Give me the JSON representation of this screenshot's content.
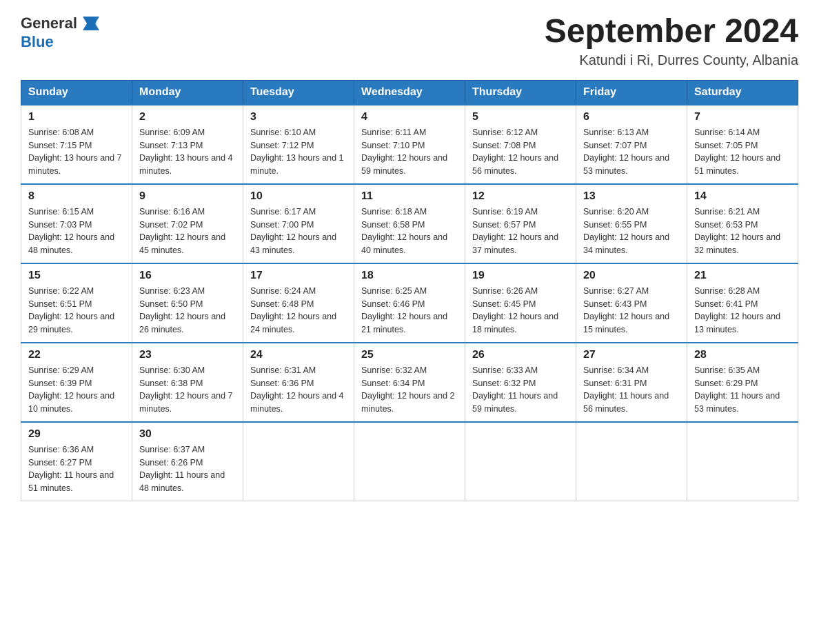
{
  "header": {
    "logo_general": "General",
    "logo_blue": "Blue",
    "month_title": "September 2024",
    "location": "Katundi i Ri, Durres County, Albania"
  },
  "weekdays": [
    "Sunday",
    "Monday",
    "Tuesday",
    "Wednesday",
    "Thursday",
    "Friday",
    "Saturday"
  ],
  "weeks": [
    [
      {
        "day": "1",
        "sunrise": "6:08 AM",
        "sunset": "7:15 PM",
        "daylight": "13 hours and 7 minutes."
      },
      {
        "day": "2",
        "sunrise": "6:09 AM",
        "sunset": "7:13 PM",
        "daylight": "13 hours and 4 minutes."
      },
      {
        "day": "3",
        "sunrise": "6:10 AM",
        "sunset": "7:12 PM",
        "daylight": "13 hours and 1 minute."
      },
      {
        "day": "4",
        "sunrise": "6:11 AM",
        "sunset": "7:10 PM",
        "daylight": "12 hours and 59 minutes."
      },
      {
        "day": "5",
        "sunrise": "6:12 AM",
        "sunset": "7:08 PM",
        "daylight": "12 hours and 56 minutes."
      },
      {
        "day": "6",
        "sunrise": "6:13 AM",
        "sunset": "7:07 PM",
        "daylight": "12 hours and 53 minutes."
      },
      {
        "day": "7",
        "sunrise": "6:14 AM",
        "sunset": "7:05 PM",
        "daylight": "12 hours and 51 minutes."
      }
    ],
    [
      {
        "day": "8",
        "sunrise": "6:15 AM",
        "sunset": "7:03 PM",
        "daylight": "12 hours and 48 minutes."
      },
      {
        "day": "9",
        "sunrise": "6:16 AM",
        "sunset": "7:02 PM",
        "daylight": "12 hours and 45 minutes."
      },
      {
        "day": "10",
        "sunrise": "6:17 AM",
        "sunset": "7:00 PM",
        "daylight": "12 hours and 43 minutes."
      },
      {
        "day": "11",
        "sunrise": "6:18 AM",
        "sunset": "6:58 PM",
        "daylight": "12 hours and 40 minutes."
      },
      {
        "day": "12",
        "sunrise": "6:19 AM",
        "sunset": "6:57 PM",
        "daylight": "12 hours and 37 minutes."
      },
      {
        "day": "13",
        "sunrise": "6:20 AM",
        "sunset": "6:55 PM",
        "daylight": "12 hours and 34 minutes."
      },
      {
        "day": "14",
        "sunrise": "6:21 AM",
        "sunset": "6:53 PM",
        "daylight": "12 hours and 32 minutes."
      }
    ],
    [
      {
        "day": "15",
        "sunrise": "6:22 AM",
        "sunset": "6:51 PM",
        "daylight": "12 hours and 29 minutes."
      },
      {
        "day": "16",
        "sunrise": "6:23 AM",
        "sunset": "6:50 PM",
        "daylight": "12 hours and 26 minutes."
      },
      {
        "day": "17",
        "sunrise": "6:24 AM",
        "sunset": "6:48 PM",
        "daylight": "12 hours and 24 minutes."
      },
      {
        "day": "18",
        "sunrise": "6:25 AM",
        "sunset": "6:46 PM",
        "daylight": "12 hours and 21 minutes."
      },
      {
        "day": "19",
        "sunrise": "6:26 AM",
        "sunset": "6:45 PM",
        "daylight": "12 hours and 18 minutes."
      },
      {
        "day": "20",
        "sunrise": "6:27 AM",
        "sunset": "6:43 PM",
        "daylight": "12 hours and 15 minutes."
      },
      {
        "day": "21",
        "sunrise": "6:28 AM",
        "sunset": "6:41 PM",
        "daylight": "12 hours and 13 minutes."
      }
    ],
    [
      {
        "day": "22",
        "sunrise": "6:29 AM",
        "sunset": "6:39 PM",
        "daylight": "12 hours and 10 minutes."
      },
      {
        "day": "23",
        "sunrise": "6:30 AM",
        "sunset": "6:38 PM",
        "daylight": "12 hours and 7 minutes."
      },
      {
        "day": "24",
        "sunrise": "6:31 AM",
        "sunset": "6:36 PM",
        "daylight": "12 hours and 4 minutes."
      },
      {
        "day": "25",
        "sunrise": "6:32 AM",
        "sunset": "6:34 PM",
        "daylight": "12 hours and 2 minutes."
      },
      {
        "day": "26",
        "sunrise": "6:33 AM",
        "sunset": "6:32 PM",
        "daylight": "11 hours and 59 minutes."
      },
      {
        "day": "27",
        "sunrise": "6:34 AM",
        "sunset": "6:31 PM",
        "daylight": "11 hours and 56 minutes."
      },
      {
        "day": "28",
        "sunrise": "6:35 AM",
        "sunset": "6:29 PM",
        "daylight": "11 hours and 53 minutes."
      }
    ],
    [
      {
        "day": "29",
        "sunrise": "6:36 AM",
        "sunset": "6:27 PM",
        "daylight": "11 hours and 51 minutes."
      },
      {
        "day": "30",
        "sunrise": "6:37 AM",
        "sunset": "6:26 PM",
        "daylight": "11 hours and 48 minutes."
      },
      null,
      null,
      null,
      null,
      null
    ]
  ],
  "labels": {
    "sunrise": "Sunrise:",
    "sunset": "Sunset:",
    "daylight": "Daylight:"
  }
}
